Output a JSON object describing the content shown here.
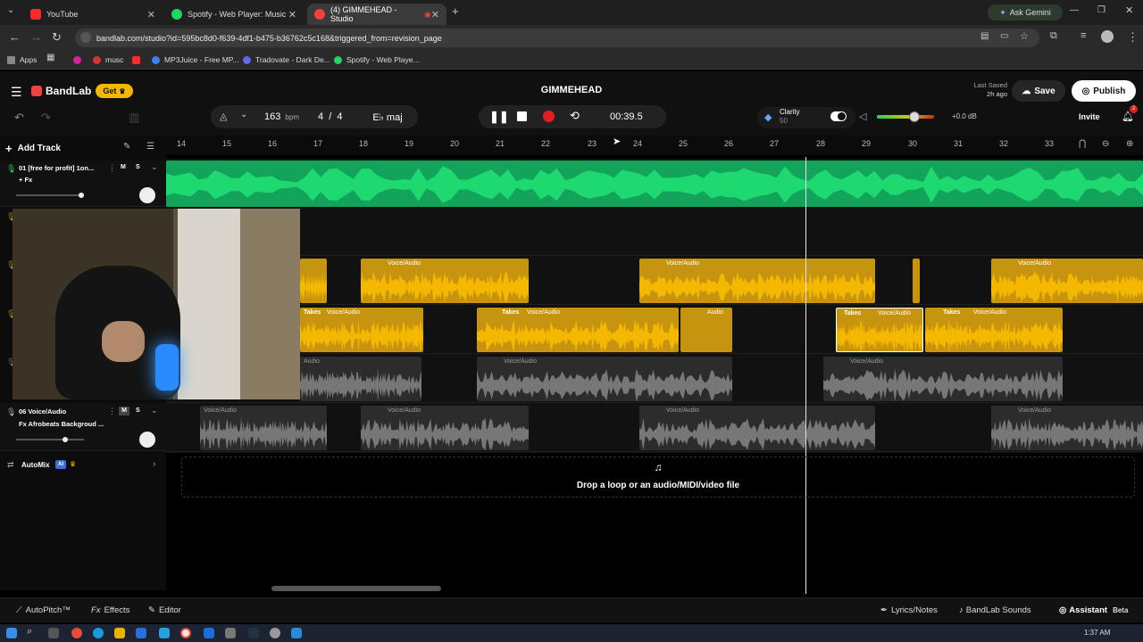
{
  "browser": {
    "tabs": [
      {
        "title": "YouTube",
        "icon": "youtube-icon",
        "color": "#ff2a2a"
      },
      {
        "title": "Spotify - Web Player: Music for",
        "icon": "spotify-icon",
        "color": "#1ed760"
      },
      {
        "title": "(4) GIMMEHEAD - Studio",
        "icon": "bandlab-icon",
        "color": "#f0423f"
      }
    ],
    "ask_gemini": "Ask Gemini",
    "url": "bandlab.com/studio?id=595bc8d0-f639-4df1-b475-b36762c5c168&triggered_from=revision_page",
    "bookmarks": [
      {
        "label": "Apps",
        "color": "#888888"
      },
      {
        "label": "musc",
        "color": "#e03131"
      },
      {
        "label": "MP3Juice - Free MP...",
        "color": "#3b82f6"
      },
      {
        "label": "Tradovate - Dark De...",
        "color": "#6366f1"
      },
      {
        "label": "Spotify - Web Playe...",
        "color": "#1ed760"
      }
    ]
  },
  "app": {
    "brand": "BandLab",
    "get_label": "Get",
    "project_title": "GIMMEHEAD",
    "last_saved_label": "Last Saved",
    "last_saved_time": "2h ago",
    "save_label": "Save",
    "publish_label": "Publish",
    "invite_label": "Invite",
    "notification_count": "2",
    "bpm_value": "163",
    "bpm_unit": "bpm",
    "time_sig_top": "4",
    "time_sig_sep": "/",
    "time_sig_bottom": "4",
    "key": "E♭ maj",
    "time": "00:39.5",
    "clarity_label": "Clarity",
    "clarity_value": "50",
    "volume_db": "+0.0 dB",
    "accent": "#f0423f"
  },
  "timeline": {
    "add_track_label": "Add Track",
    "ruler": [
      "14",
      "15",
      "16",
      "17",
      "18",
      "19",
      "20",
      "21",
      "22",
      "23",
      "24",
      "25",
      "26",
      "27",
      "28",
      "29",
      "30",
      "31",
      "32",
      "33"
    ],
    "drop_text": "Drop a loop or an audio/MIDI/video file"
  },
  "tracks": {
    "t1_name": "01  [free for profit] 1on...",
    "t1_fx": "+ Fx",
    "t6_name": "06  Voice/Audio",
    "t6_fx": "Fx Afrobeats Backgroud ...",
    "mute": "M",
    "solo": "S",
    "automix": "AutoMix",
    "ai_badge": "AI"
  },
  "clip_labels": {
    "voice": "Voice/Audio",
    "takes": "Takes",
    "audio": "Audio"
  },
  "bottom": {
    "autopitch": "AutoPitch™",
    "effects": "Effects",
    "editor": "Editor",
    "lyrics": "Lyrics/Notes",
    "sounds": "BandLab Sounds",
    "assistant": "Assistant",
    "beta": "Beta"
  },
  "taskbar": {
    "clock": "1:37 AM"
  }
}
